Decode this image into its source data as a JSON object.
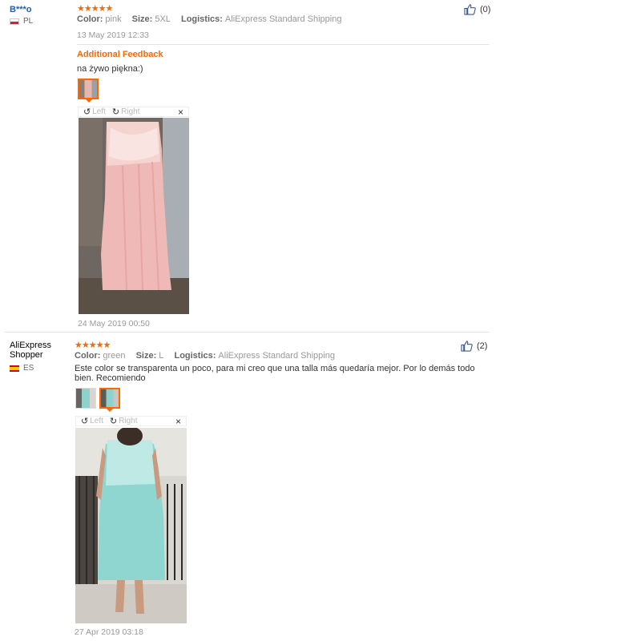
{
  "reviews": [
    {
      "author": "B***o",
      "country": "PL",
      "stars": "★★★★★",
      "attrs": {
        "color_label": "Color:",
        "color_value": "pink",
        "size_label": "Size:",
        "size_value": "5XL",
        "logistics_label": "Logistics:",
        "logistics_value": "AliExpress Standard Shipping"
      },
      "date": "13 May 2019 12:33",
      "likes": "(0)",
      "additional_title": "Additional Feedback",
      "additional_text": "na żywo piękna:)",
      "viewer": {
        "left": "Left",
        "right": "Right",
        "close": "×"
      },
      "additional_date": "24 May 2019 00:50"
    },
    {
      "author": "AliExpress\nShopper",
      "country": "ES",
      "stars": "★★★★★",
      "attrs": {
        "color_label": "Color:",
        "color_value": "green",
        "size_label": "Size:",
        "size_value": "L",
        "logistics_label": "Logistics:",
        "logistics_value": "AliExpress Standard Shipping"
      },
      "text": "Este color se transparenta un poco, para mi creo que una talla más quedaría mejor. Por lo demás todo bien. Recomiendo",
      "likes": "(2)",
      "viewer": {
        "left": "Left",
        "right": "Right",
        "close": "×"
      },
      "date": "27 Apr 2019 03:18"
    }
  ],
  "icons": {
    "like": "thumbs-up-icon",
    "rotate_left": "rotate-left-icon",
    "rotate_right": "rotate-right-icon",
    "close": "close-icon"
  }
}
